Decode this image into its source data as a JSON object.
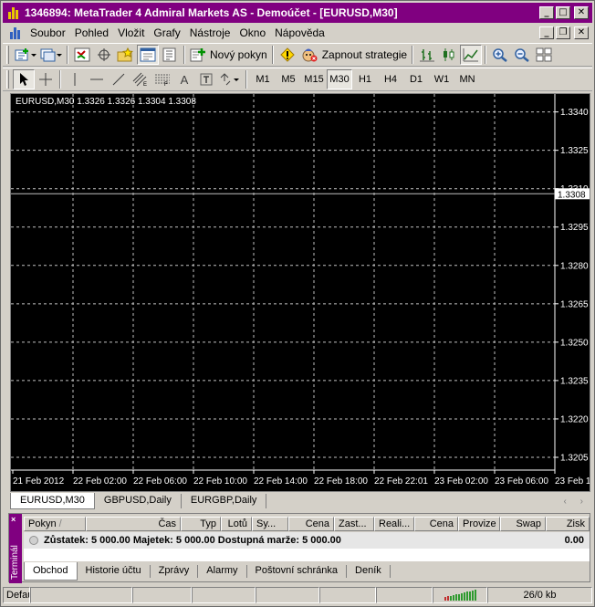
{
  "window": {
    "title": "1346894: MetaTrader 4 Admiral Markets AS - Demoúčet - [EURUSD,M30]",
    "minimize": "_",
    "maximize": "□",
    "close": "✕",
    "restore": "❐"
  },
  "menu": {
    "items": [
      "Soubor",
      "Pohled",
      "Vložit",
      "Grafy",
      "Nástroje",
      "Okno",
      "Nápověda"
    ]
  },
  "toolbar1": {
    "new_order": "Nový pokyn",
    "autotrading": "Zapnout strategie"
  },
  "toolbar2": {
    "text_tool": "A",
    "timeframes": [
      "M1",
      "M5",
      "M15",
      "M30",
      "H1",
      "H4",
      "D1",
      "W1",
      "MN"
    ],
    "active_timeframe": "M30"
  },
  "chart": {
    "header": "EURUSD,M30  1.3326 1.3326 1.3304 1.3308",
    "current_price_label": "1.3308",
    "colors": {
      "background": "#000000",
      "grid": "#c0c0c0",
      "axis": "#ffffff",
      "price_line": "#c0c0c0"
    }
  },
  "chart_data": {
    "type": "line",
    "symbol": "EURUSD",
    "timeframe": "M30",
    "ohlc": {
      "open": 1.3326,
      "high": 1.3326,
      "low": 1.3304,
      "close": 1.3308
    },
    "y_ticks": [
      "1.3340",
      "1.3325",
      "1.3310",
      "1.3295",
      "1.3280",
      "1.3265",
      "1.3250",
      "1.3235",
      "1.3220",
      "1.3205"
    ],
    "x_ticks": [
      "21 Feb 2012",
      "22 Feb 02:00",
      "22 Feb 06:00",
      "22 Feb 10:00",
      "22 Feb 14:00",
      "22 Feb 18:00",
      "22 Feb 22:01",
      "23 Feb 02:00",
      "23 Feb 06:00",
      "23 Feb 10:00"
    ],
    "ylim": [
      1.32,
      1.3347
    ],
    "current_price": 1.3308,
    "grid": true,
    "series": []
  },
  "chart_tabs": {
    "items": [
      "EURUSD,M30",
      "GBPUSD,Daily",
      "EURGBP,Daily"
    ],
    "nav": "‹ ›"
  },
  "terminal": {
    "close": "×",
    "side_label": "Terminál",
    "columns": [
      "Pokyn",
      "Čas",
      "Typ",
      "Lotů",
      "Sy...",
      "Cena",
      "Zast...",
      "Reali...",
      "Cena",
      "Provize",
      "Swap",
      "Zisk"
    ],
    "sort_indicator": "/",
    "balance_line": "Zůstatek: 5 000.00  Majetek: 5 000.00  Dostupná marže: 5 000.00",
    "total_profit": "0.00",
    "tabs": [
      "Obchod",
      "Historie účtu",
      "Zprávy",
      "Alarmy",
      "Poštovní schránka",
      "Deník"
    ]
  },
  "status": {
    "profile": "Default",
    "connection": "26/0 kb",
    "connection_color": "#2e9a2e"
  }
}
